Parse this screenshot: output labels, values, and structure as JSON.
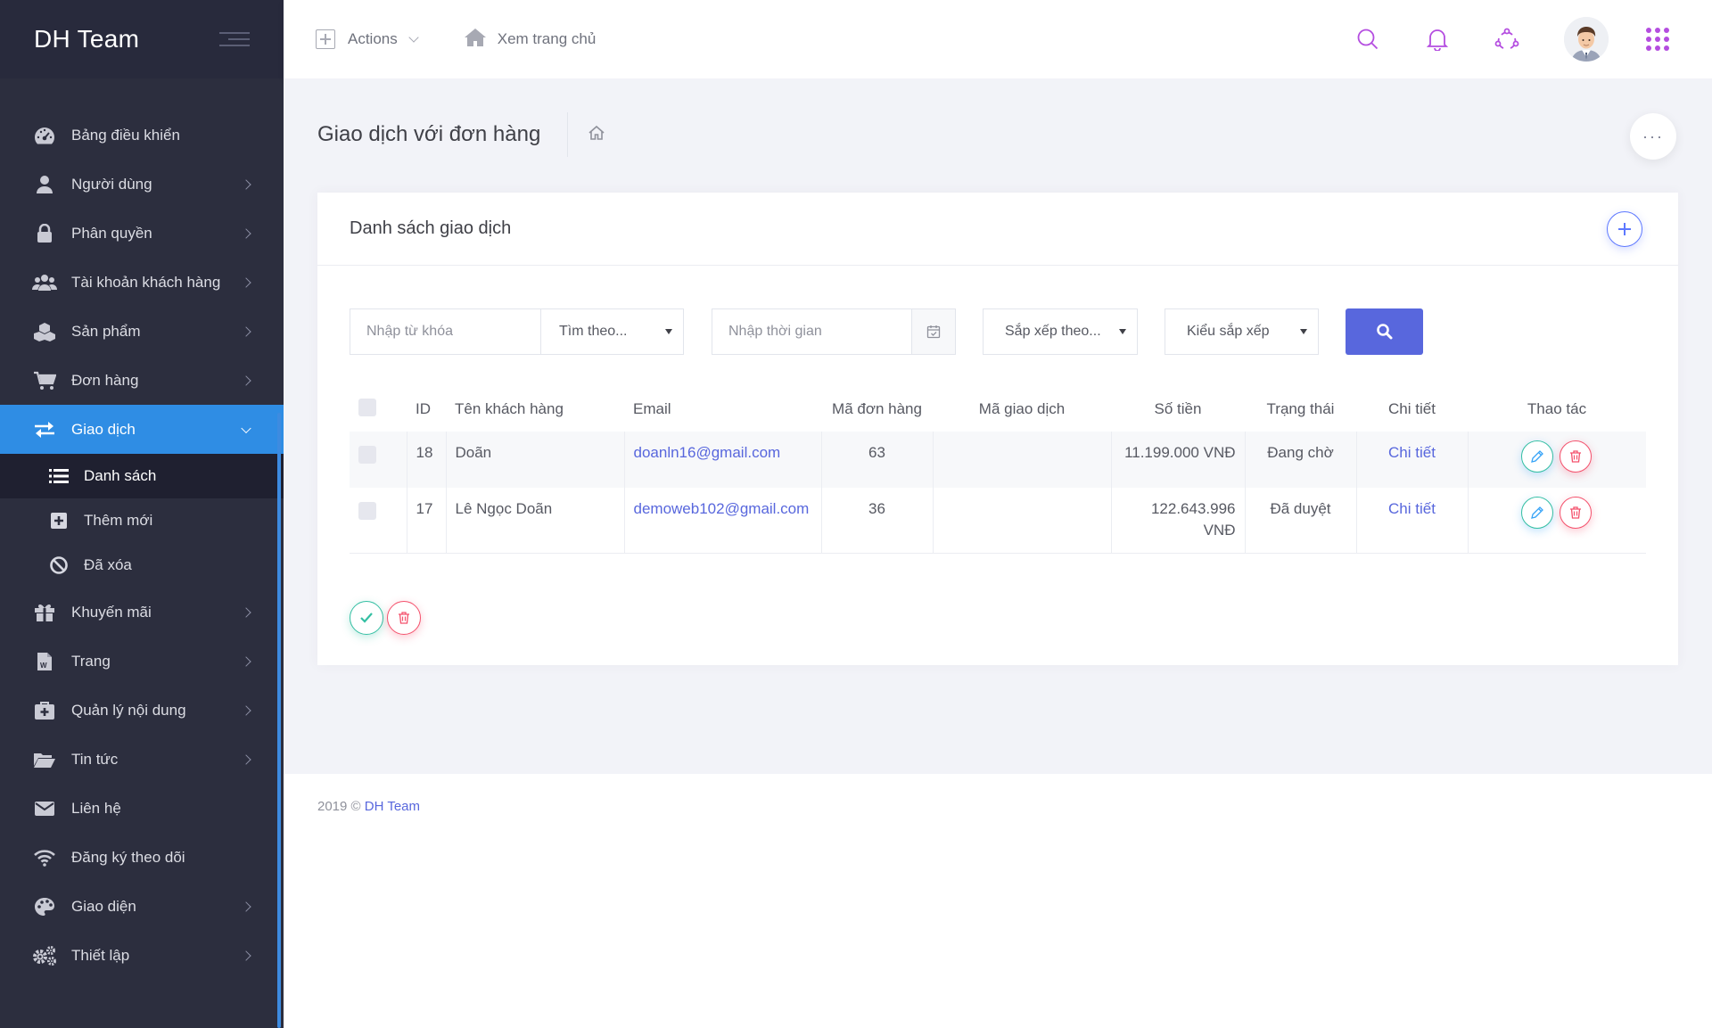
{
  "brand": {
    "title": "DH Team"
  },
  "topbar": {
    "actions_label": "Actions",
    "home_label": "Xem trang chủ"
  },
  "sidebar": {
    "items": [
      {
        "label": "Bảng điều khiển",
        "icon": "dashboard-icon",
        "has_children": false
      },
      {
        "label": "Người dùng",
        "icon": "user-icon",
        "has_children": true
      },
      {
        "label": "Phân quyền",
        "icon": "lock-icon",
        "has_children": true
      },
      {
        "label": "Tài khoản khách hàng",
        "icon": "users-icon",
        "has_children": true
      },
      {
        "label": "Sản phẩm",
        "icon": "cubes-icon",
        "has_children": true
      },
      {
        "label": "Đơn hàng",
        "icon": "cart-icon",
        "has_children": true
      },
      {
        "label": "Giao dịch",
        "icon": "exchange-icon",
        "has_children": true,
        "active": true
      },
      {
        "label": "Khuyến mãi",
        "icon": "gift-icon",
        "has_children": true
      },
      {
        "label": "Trang",
        "icon": "word-file-icon",
        "has_children": true
      },
      {
        "label": "Quản lý nội dung",
        "icon": "medkit-icon",
        "has_children": true
      },
      {
        "label": "Tin tức",
        "icon": "folder-open-icon",
        "has_children": true
      },
      {
        "label": "Liên hệ",
        "icon": "envelope-icon",
        "has_children": false
      },
      {
        "label": "Đăng ký theo dõi",
        "icon": "wifi-icon",
        "has_children": false
      },
      {
        "label": "Giao diện",
        "icon": "palette-icon",
        "has_children": true
      },
      {
        "label": "Thiết lập",
        "icon": "cogs-icon",
        "has_children": true
      }
    ],
    "submenu": [
      {
        "label": "Danh sách",
        "icon": "list-icon",
        "current": true
      },
      {
        "label": "Thêm mới",
        "icon": "plus-square-icon"
      },
      {
        "label": "Đã xóa",
        "icon": "ban-icon"
      }
    ]
  },
  "page": {
    "title": "Giao dịch với đơn hàng",
    "more": "···"
  },
  "portlet": {
    "title": "Danh sách giao dịch"
  },
  "filters": {
    "keyword_placeholder": "Nhập từ khóa",
    "search_by": "Tìm theo...",
    "time_placeholder": "Nhập thời gian",
    "sort_by": "Sắp xếp theo...",
    "sort_type": "Kiểu sắp xếp"
  },
  "table": {
    "columns": [
      "ID",
      "Tên khách hàng",
      "Email",
      "Mã đơn hàng",
      "Mã giao dịch",
      "Số tiền",
      "Trạng thái",
      "Chi tiết",
      "Thao tác"
    ],
    "rows": [
      {
        "id": "18",
        "customer": "Doãn",
        "email": "doanln16@gmail.com",
        "order_code": "63",
        "txn_code": "",
        "amount": "11.199.000 VNĐ",
        "status": "Đang chờ",
        "detail": "Chi tiết"
      },
      {
        "id": "17",
        "customer": "Lê Ngọc Doãn",
        "email": "demoweb102@gmail.com",
        "order_code": "36",
        "txn_code": "",
        "amount": "122.643.996 VNĐ",
        "status": "Đã duyệt",
        "detail": "Chi tiết"
      }
    ]
  },
  "footer": {
    "prefix": "2019 ©",
    "brand": "DH Team"
  },
  "colors": {
    "sidebar_bg": "#2c2e3e",
    "active": "#2f8de4",
    "primary": "#5867dd",
    "success": "#34bfa3",
    "danger": "#f4516c",
    "accent_icons": "#b44de0"
  }
}
